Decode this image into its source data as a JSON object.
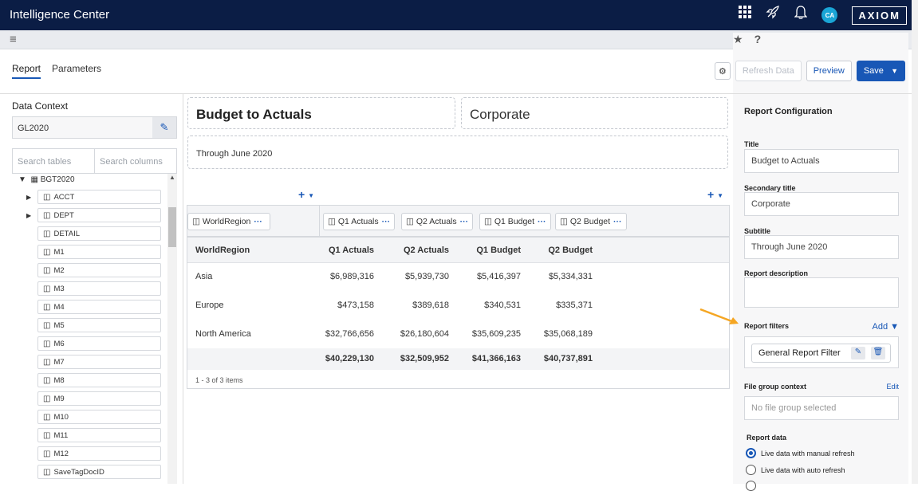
{
  "app": {
    "title": "Intelligence Center",
    "brand": "AXIOM",
    "avatar": "CA"
  },
  "topbar_icons": [
    "apps-grid-icon",
    "rocket-icon",
    "bell-icon"
  ],
  "subbar": {
    "star": "★",
    "help": "?"
  },
  "tabs": [
    {
      "label": "Report",
      "active": true
    },
    {
      "label": "Parameters",
      "active": false
    }
  ],
  "actions": {
    "settings_icon": "gear-icon",
    "refresh": "Refresh Data",
    "preview": "Preview",
    "save": "Save",
    "save_caret": "▼"
  },
  "left": {
    "data_context_label": "Data Context",
    "data_context_value": "GL2020",
    "search_tables": "Search tables",
    "search_columns": "Search columns",
    "root": "BGT2020",
    "items": [
      "ACCT",
      "DEPT",
      "DETAIL",
      "M1",
      "M2",
      "M3",
      "M4",
      "M5",
      "M6",
      "M7",
      "M8",
      "M9",
      "M10",
      "M11",
      "M12",
      "SaveTagDocID"
    ]
  },
  "report": {
    "title": "Budget to Actuals",
    "secondary": "Corporate",
    "subtitle": "Through June 2020",
    "add_symbol": "+",
    "row_dim": "WorldRegion",
    "col_dims": [
      "Q1 Actuals",
      "Q2 Actuals",
      "Q1 Budget",
      "Q2 Budget"
    ],
    "columns": [
      "WorldRegion",
      "Q1 Actuals",
      "Q2 Actuals",
      "Q1 Budget",
      "Q2 Budget"
    ],
    "rows": [
      [
        "Asia",
        "$6,989,316",
        "$5,939,730",
        "$5,416,397",
        "$5,334,331"
      ],
      [
        "Europe",
        "$473,158",
        "$389,618",
        "$340,531",
        "$335,371"
      ],
      [
        "North America",
        "$32,766,656",
        "$26,180,604",
        "$35,609,235",
        "$35,068,189"
      ]
    ],
    "totals": [
      "$40,229,130",
      "$32,509,952",
      "$41,366,163",
      "$40,737,891"
    ],
    "footer": "1 - 3 of 3 items"
  },
  "config": {
    "heading": "Report Configuration",
    "title_label": "Title",
    "title_value": "Budget to Actuals",
    "secondary_label": "Secondary title",
    "secondary_value": "Corporate",
    "subtitle_label": "Subtitle",
    "subtitle_value": "Through June 2020",
    "desc_label": "Report description",
    "desc_value": "",
    "filters_label": "Report filters",
    "filters_add": "Add ▼",
    "filter_chip": "General Report Filter",
    "filegroup_label": "File group context",
    "filegroup_edit": "Edit",
    "filegroup_placeholder": "No file group selected",
    "reportdata_label": "Report data",
    "radio_manual": "Live data with manual refresh",
    "radio_auto": "Live data with auto refresh"
  },
  "colors": {
    "navy": "#0b1d45",
    "accent": "#1857b6",
    "annotation_arrow": "#f5a623"
  }
}
